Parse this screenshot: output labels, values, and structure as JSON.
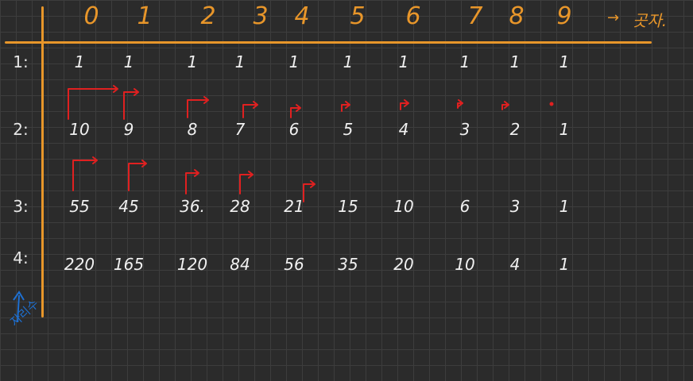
{
  "columns": [
    "0",
    "1",
    "2",
    "3",
    "4",
    "5",
    "6",
    "7",
    "8",
    "9"
  ],
  "corner_label": "곳자.",
  "arrow": "→",
  "rows": [
    {
      "label": "1:",
      "values": [
        "1",
        "1",
        "1",
        "1",
        "1",
        "1",
        "1",
        "1",
        "1",
        "1"
      ]
    },
    {
      "label": "2:",
      "values": [
        "10",
        "9",
        "8",
        "7",
        "6",
        "5",
        "4",
        "3",
        "2",
        "1"
      ]
    },
    {
      "label": "3:",
      "values": [
        "55",
        "45",
        "36.",
        "28",
        "21",
        "15",
        "10",
        "6",
        "3",
        "1"
      ]
    },
    {
      "label": "4:",
      "values": [
        "220",
        "165",
        "120",
        "84",
        "56",
        "35",
        "20",
        "10",
        "4",
        "1"
      ]
    }
  ],
  "side_note": "자리수",
  "colors": {
    "accent": "#e8962a",
    "marks": "#e02020",
    "note": "#1e6fd0",
    "ink": "#f0f0f0"
  }
}
